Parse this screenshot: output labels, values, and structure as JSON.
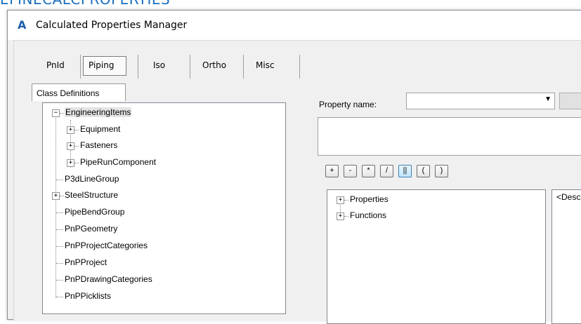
{
  "background_heading": "EFINECALCPROPERTIES",
  "window": {
    "title": "Calculated Properties Manager",
    "icon": "autocad-a-icon"
  },
  "category_tabs": [
    {
      "label": "PnId"
    },
    {
      "label": "Piping",
      "selected": true
    },
    {
      "label": "Iso"
    },
    {
      "label": "Ortho"
    },
    {
      "label": "Misc"
    }
  ],
  "class_tab_label": "Class Definitions",
  "tree": {
    "engineering_items": "EngineeringItems",
    "equipment": "Equipment",
    "fasteners": "Fasteners",
    "pipe_run_component": "PipeRunComponent",
    "p3d_line_group": "P3dLineGroup",
    "steel_structure": "SteelStructure",
    "pipe_bend_group": "PipeBendGroup",
    "pnp_geometry": "PnPGeometry",
    "pnp_project_categories": "PnPProjectCategories",
    "pnp_project": "PnPProject",
    "pnp_drawing_categories": "PnPDrawingCategories",
    "pnp_picklists": "PnPPicklists"
  },
  "property_name_label": "Property name:",
  "property_name_value": "",
  "expression_value": "",
  "operators": [
    "+",
    "-",
    "*",
    "/",
    "||",
    "(",
    ")"
  ],
  "function_tree": {
    "properties": "Properties",
    "functions": "Functions"
  },
  "description": "<Desc"
}
